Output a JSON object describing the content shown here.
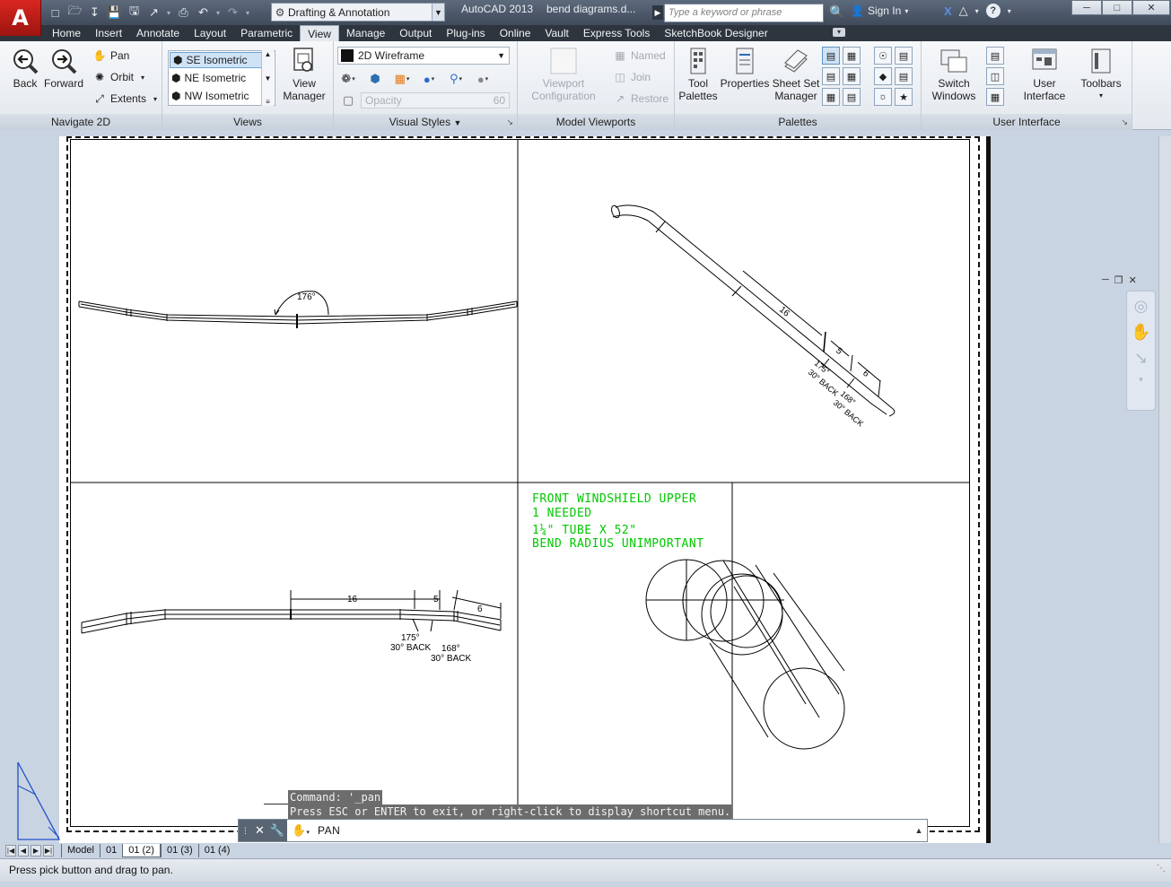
{
  "app": {
    "logo_letter": "A",
    "name": "AutoCAD 2013",
    "filename": "bend diagrams.d..."
  },
  "workspace": {
    "label": "Drafting & Annotation"
  },
  "search": {
    "placeholder": "Type a keyword or phrase"
  },
  "account": {
    "sign_in": "Sign In"
  },
  "ribbon_tabs": [
    "Home",
    "Insert",
    "Annotate",
    "Layout",
    "Parametric",
    "View",
    "Manage",
    "Output",
    "Plug-ins",
    "Online",
    "Vault",
    "Express Tools",
    "SketchBook Designer"
  ],
  "active_tab": "View",
  "panels": {
    "navigate": {
      "title": "Navigate 2D",
      "back": "Back",
      "forward": "Forward",
      "pan": "Pan",
      "orbit": "Orbit",
      "extents": "Extents"
    },
    "views": {
      "title": "Views",
      "items": [
        "SE Isometric",
        "NE Isometric",
        "NW Isometric"
      ],
      "selected": "SE Isometric",
      "manager_line1": "View",
      "manager_line2": "Manager"
    },
    "visual_styles": {
      "title": "Visual Styles",
      "current": "2D Wireframe",
      "opacity_label": "Opacity",
      "opacity_value": "60"
    },
    "model_viewports": {
      "title": "Model Viewports",
      "config_line1": "Viewport",
      "config_line2": "Configuration",
      "named": "Named",
      "join": "Join",
      "restore": "Restore"
    },
    "palettes": {
      "title": "Palettes",
      "tool_line1": "Tool",
      "tool_line2": "Palettes",
      "properties": "Properties",
      "sheetset_line1": "Sheet Set",
      "sheetset_line2": "Manager"
    },
    "user_interface": {
      "title": "User Interface",
      "switch_line1": "Switch",
      "switch_line2": "Windows",
      "ui_line1": "User",
      "ui_line2": "Interface",
      "toolbars": "Toolbars"
    }
  },
  "drawing": {
    "top_left_angle": "176°",
    "iso_dim_16": "16",
    "iso_dim_5": "5",
    "iso_dim_6": "6",
    "iso_angle_175": "175°",
    "iso_back_1": "30° BACK",
    "iso_angle_168": "168°",
    "iso_back_2": "30° BACK",
    "bottom_dim_16": "16",
    "bottom_dim_5": "5",
    "bottom_dim_6": "6",
    "bottom_angle_175": "175°",
    "bottom_back_1": "30° BACK",
    "bottom_angle_168": "168°",
    "bottom_back_2": "30° BACK",
    "note_line1": "FRONT WINDSHIELD UPPER",
    "note_line2": "1 NEEDED",
    "note_line3": "1¼\" TUBE X 52\"",
    "note_line4": "BEND RADIUS UNIMPORTANT",
    "note_color": "#00c800"
  },
  "command": {
    "history_1": "Command: '_pan",
    "history_2": "Press ESC or ENTER to exit, or right-click to display shortcut menu.",
    "current": "PAN"
  },
  "layout_tabs": [
    "Model",
    "01",
    "01 (2)",
    "01 (3)",
    "01 (4)"
  ],
  "active_layout": "Model",
  "status": {
    "message": "Press pick button and drag to pan."
  },
  "colors": {
    "app_red": "#c8221b",
    "title_bar": "#4a5566",
    "tab_bar": "#2e353f",
    "ribbon": "#eef1f5",
    "background": "#c9d4e2",
    "selection": "#cfe3f7"
  }
}
